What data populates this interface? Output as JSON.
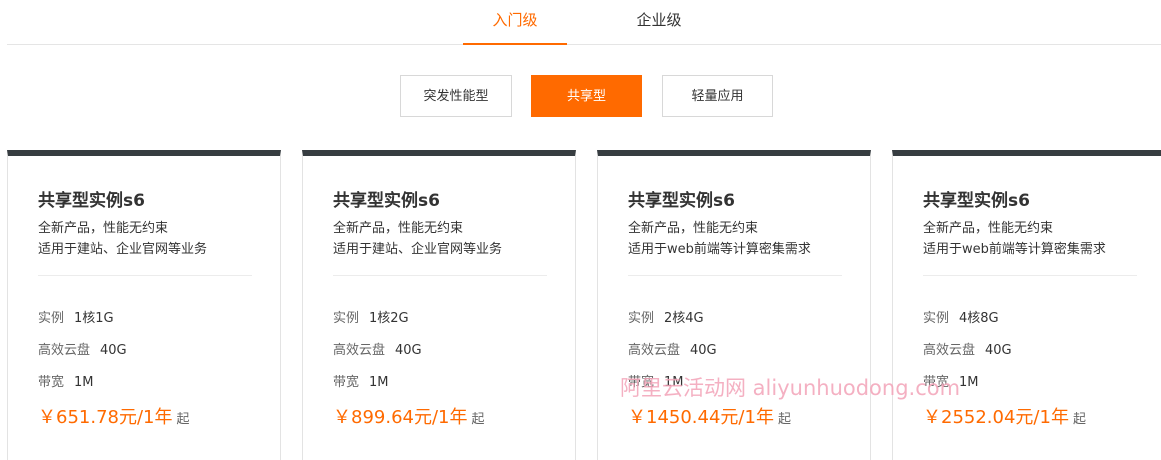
{
  "tabs": [
    {
      "label": "入门级",
      "active": true
    },
    {
      "label": "企业级",
      "active": false
    }
  ],
  "filters": [
    {
      "label": "突发性能型",
      "active": false
    },
    {
      "label": "共享型",
      "active": true
    },
    {
      "label": "轻量应用",
      "active": false
    }
  ],
  "cards": [
    {
      "title": "共享型实例s6",
      "desc1": "全新产品，性能无约束",
      "desc2": "适用于建站、企业官网等业务",
      "spec_instance_label": "实例",
      "spec_instance_value": "1核1G",
      "spec_disk_label": "高效云盘",
      "spec_disk_value": "40G",
      "spec_bw_label": "带宽",
      "spec_bw_value": "1M",
      "price": "￥651.78元/1年",
      "price_suffix": "起"
    },
    {
      "title": "共享型实例s6",
      "desc1": "全新产品，性能无约束",
      "desc2": "适用于建站、企业官网等业务",
      "spec_instance_label": "实例",
      "spec_instance_value": "1核2G",
      "spec_disk_label": "高效云盘",
      "spec_disk_value": "40G",
      "spec_bw_label": "带宽",
      "spec_bw_value": "1M",
      "price": "￥899.64元/1年",
      "price_suffix": "起"
    },
    {
      "title": "共享型实例s6",
      "desc1": "全新产品，性能无约束",
      "desc2": "适用于web前端等计算密集需求",
      "spec_instance_label": "实例",
      "spec_instance_value": "2核4G",
      "spec_disk_label": "高效云盘",
      "spec_disk_value": "40G",
      "spec_bw_label": "带宽",
      "spec_bw_value": "1M",
      "price": "￥1450.44元/1年",
      "price_suffix": "起"
    },
    {
      "title": "共享型实例s6",
      "desc1": "全新产品，性能无约束",
      "desc2": "适用于web前端等计算密集需求",
      "spec_instance_label": "实例",
      "spec_instance_value": "4核8G",
      "spec_disk_label": "高效云盘",
      "spec_disk_value": "40G",
      "spec_bw_label": "带宽",
      "spec_bw_value": "1M",
      "price": "￥2552.04元/1年",
      "price_suffix": "起"
    }
  ],
  "watermark": "阿里云活动网 aliyunhuodong.com",
  "colors": {
    "accent": "#ff6a00",
    "card_top_border": "#373d41",
    "watermark": "#f3a3b8"
  }
}
